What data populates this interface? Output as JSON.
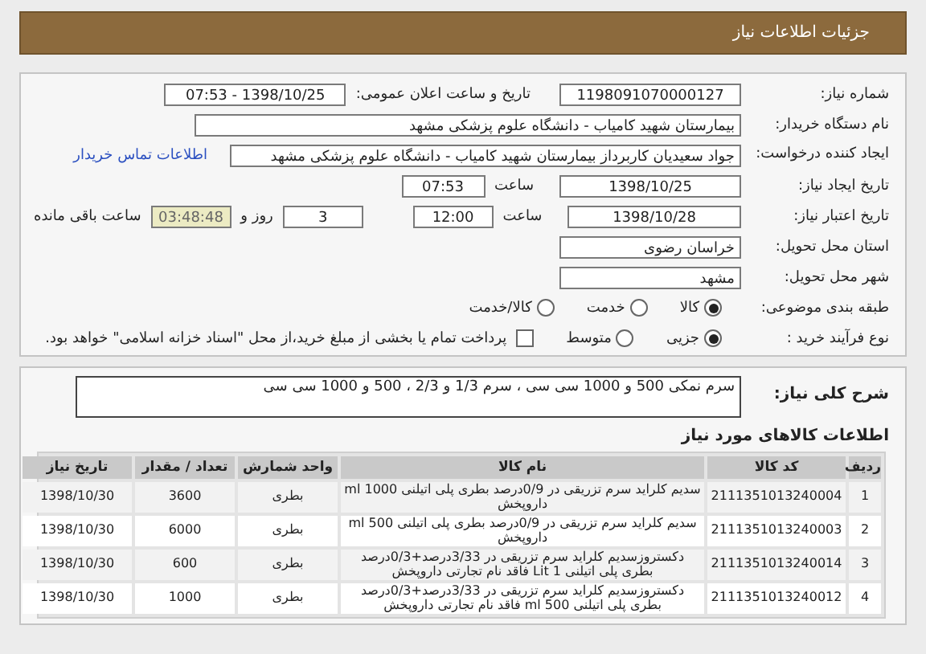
{
  "header": {
    "title": "جزئیات اطلاعات نیاز"
  },
  "need_number": {
    "label": "شماره نیاز:",
    "value": "1198091070000127"
  },
  "announce": {
    "label": "تاریخ و ساعت اعلان عمومی:",
    "value": "1398/10/25 - 07:53"
  },
  "buyer": {
    "label": "نام دستگاه خریدار:",
    "value": "بیمارستان شهید کامیاب - دانشگاه علوم پزشکی مشهد"
  },
  "creator": {
    "label": "ایجاد کننده درخواست:",
    "value": "جواد سعیدیان کاربرداز بیمارستان شهید کامیاب - دانشگاه علوم پزشکی مشهد",
    "link": "اطلاعات تماس خریدار"
  },
  "created": {
    "label": "تاریخ ایجاد نیاز:",
    "date": "1398/10/25",
    "time_label": "ساعت",
    "time": "07:53"
  },
  "validity": {
    "label": "تاریخ اعتبار نیاز:",
    "date": "1398/10/28",
    "time_label": "ساعت",
    "time": "12:00",
    "days": "3",
    "days_label": "روز و",
    "remaining": "03:48:48",
    "remaining_label": "ساعت باقی مانده"
  },
  "province": {
    "label": "استان محل تحویل:",
    "value": "خراسان رضوی"
  },
  "city": {
    "label": "شهر محل تحویل:",
    "value": "مشهد"
  },
  "category": {
    "label": "طبقه بندی موضوعی:",
    "options": [
      {
        "label": "کالا",
        "selected": true
      },
      {
        "label": "خدمت",
        "selected": false
      },
      {
        "label": "کالا/خدمت",
        "selected": false
      }
    ]
  },
  "process": {
    "label": "نوع فرآیند خرید :",
    "options": [
      {
        "label": "جزیی",
        "selected": true
      },
      {
        "label": "متوسط",
        "selected": false
      }
    ],
    "treasury": {
      "label": "پرداخت تمام یا بخشی از مبلغ خرید،از محل \"اسناد خزانه اسلامی\" خواهد بود.",
      "checked": false
    }
  },
  "description": {
    "label": "شرح کلی نیاز:",
    "value": "سرم نمکی 500 و 1000 سی سی ، سرم 1/3 و 2/3 ، 500 و 1000 سی سی"
  },
  "goods": {
    "title": "اطلاعات کالاهای مورد نیاز",
    "columns": [
      "ردیف",
      "کد کالا",
      "نام کالا",
      "واحد شمارش",
      "تعداد / مقدار",
      "تاریخ نیاز"
    ],
    "rows": [
      [
        "1",
        "2111351013240004",
        "سدیم کلراید سرم تزریقی در 0/9درصد بطری پلی اتیلنی 1000 ml داروپخش",
        "بطری",
        "3600",
        "1398/10/30"
      ],
      [
        "2",
        "2111351013240003",
        "سدیم کلراید سرم تزریقی در 0/9درصد بطری پلی اتیلنی 500 ml داروپخش",
        "بطری",
        "6000",
        "1398/10/30"
      ],
      [
        "3",
        "2111351013240014",
        "دکستروزسدیم کلراید سرم تزریقی در 3/33درصد+0/3درصد بطری پلی اتیلنی 1 Lit فاقد نام تجارتی داروپخش",
        "بطری",
        "600",
        "1398/10/30"
      ],
      [
        "4",
        "2111351013240012",
        "دکستروزسدیم کلراید سرم تزریقی در 3/33درصد+0/3درصد بطری پلی اتیلنی 500 ml فاقد نام تجارتی داروپخش",
        "بطری",
        "1000",
        "1398/10/30"
      ]
    ]
  }
}
